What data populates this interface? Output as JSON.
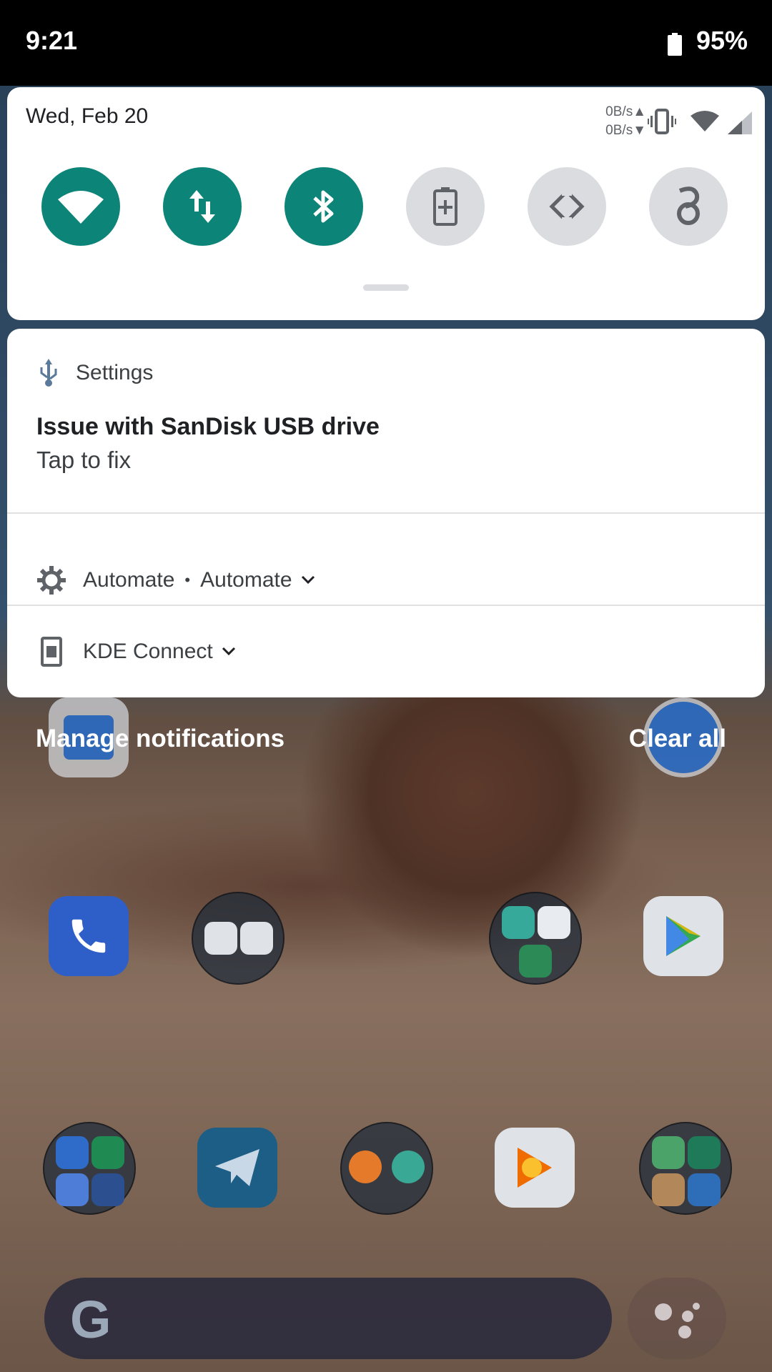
{
  "status_bar": {
    "time": "9:21",
    "battery_percent": "95%"
  },
  "quick_settings": {
    "date": "Wed, Feb 20",
    "upload_speed": "0B/s▲",
    "download_speed": "0B/s▼",
    "accent_color": "#0c8477",
    "tiles": [
      {
        "name": "wifi",
        "icon": "wifi-icon",
        "state": "on"
      },
      {
        "name": "mobile-data",
        "icon": "data-arrows-icon",
        "state": "on"
      },
      {
        "name": "bluetooth",
        "icon": "bluetooth-icon",
        "state": "on"
      },
      {
        "name": "battery-saver",
        "icon": "battery-saver-icon",
        "state": "off"
      },
      {
        "name": "auto-rotate",
        "icon": "rotate-icon",
        "state": "off"
      },
      {
        "name": "vpn",
        "icon": "wireguard-icon",
        "state": "off"
      }
    ]
  },
  "notifications": {
    "usb": {
      "app": "Settings",
      "title": "Issue with SanDisk USB drive",
      "text": "Tap to fix"
    },
    "automate": {
      "app": "Automate",
      "sub": "Automate"
    },
    "kde": {
      "app": "KDE Connect"
    }
  },
  "footer": {
    "manage": "Manage notifications",
    "clear_all": "Clear all"
  }
}
